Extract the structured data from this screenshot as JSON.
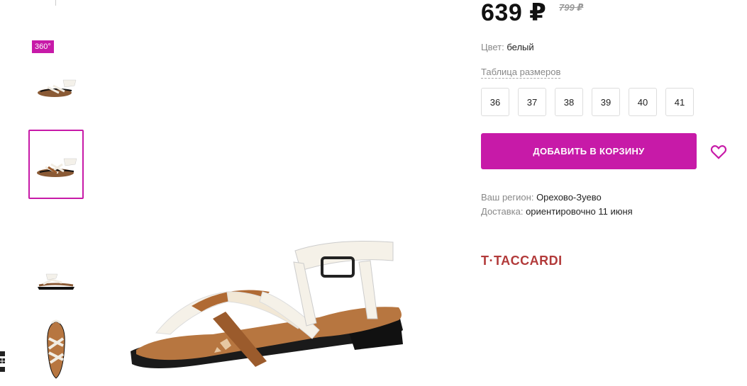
{
  "product": {
    "price": "639 ₽",
    "old_price": "799 ₽",
    "color_label": "Цвет:",
    "color_value": "белый",
    "size_table_link": "Таблица размеров",
    "sizes": [
      "36",
      "37",
      "38",
      "39",
      "40",
      "41"
    ],
    "add_to_cart": "ДОБАВИТЬ В КОРЗИНУ",
    "brand": "T·TACCARDI"
  },
  "gallery": {
    "badge_360": "360°"
  },
  "delivery": {
    "region_label": "Ваш регион:",
    "region_value": "Орехово-Зуево",
    "delivery_label": "Доставка:",
    "delivery_value": "ориентировочно 11 июня"
  },
  "colors": {
    "accent": "#c71aa8",
    "brand": "#b23a3a"
  }
}
